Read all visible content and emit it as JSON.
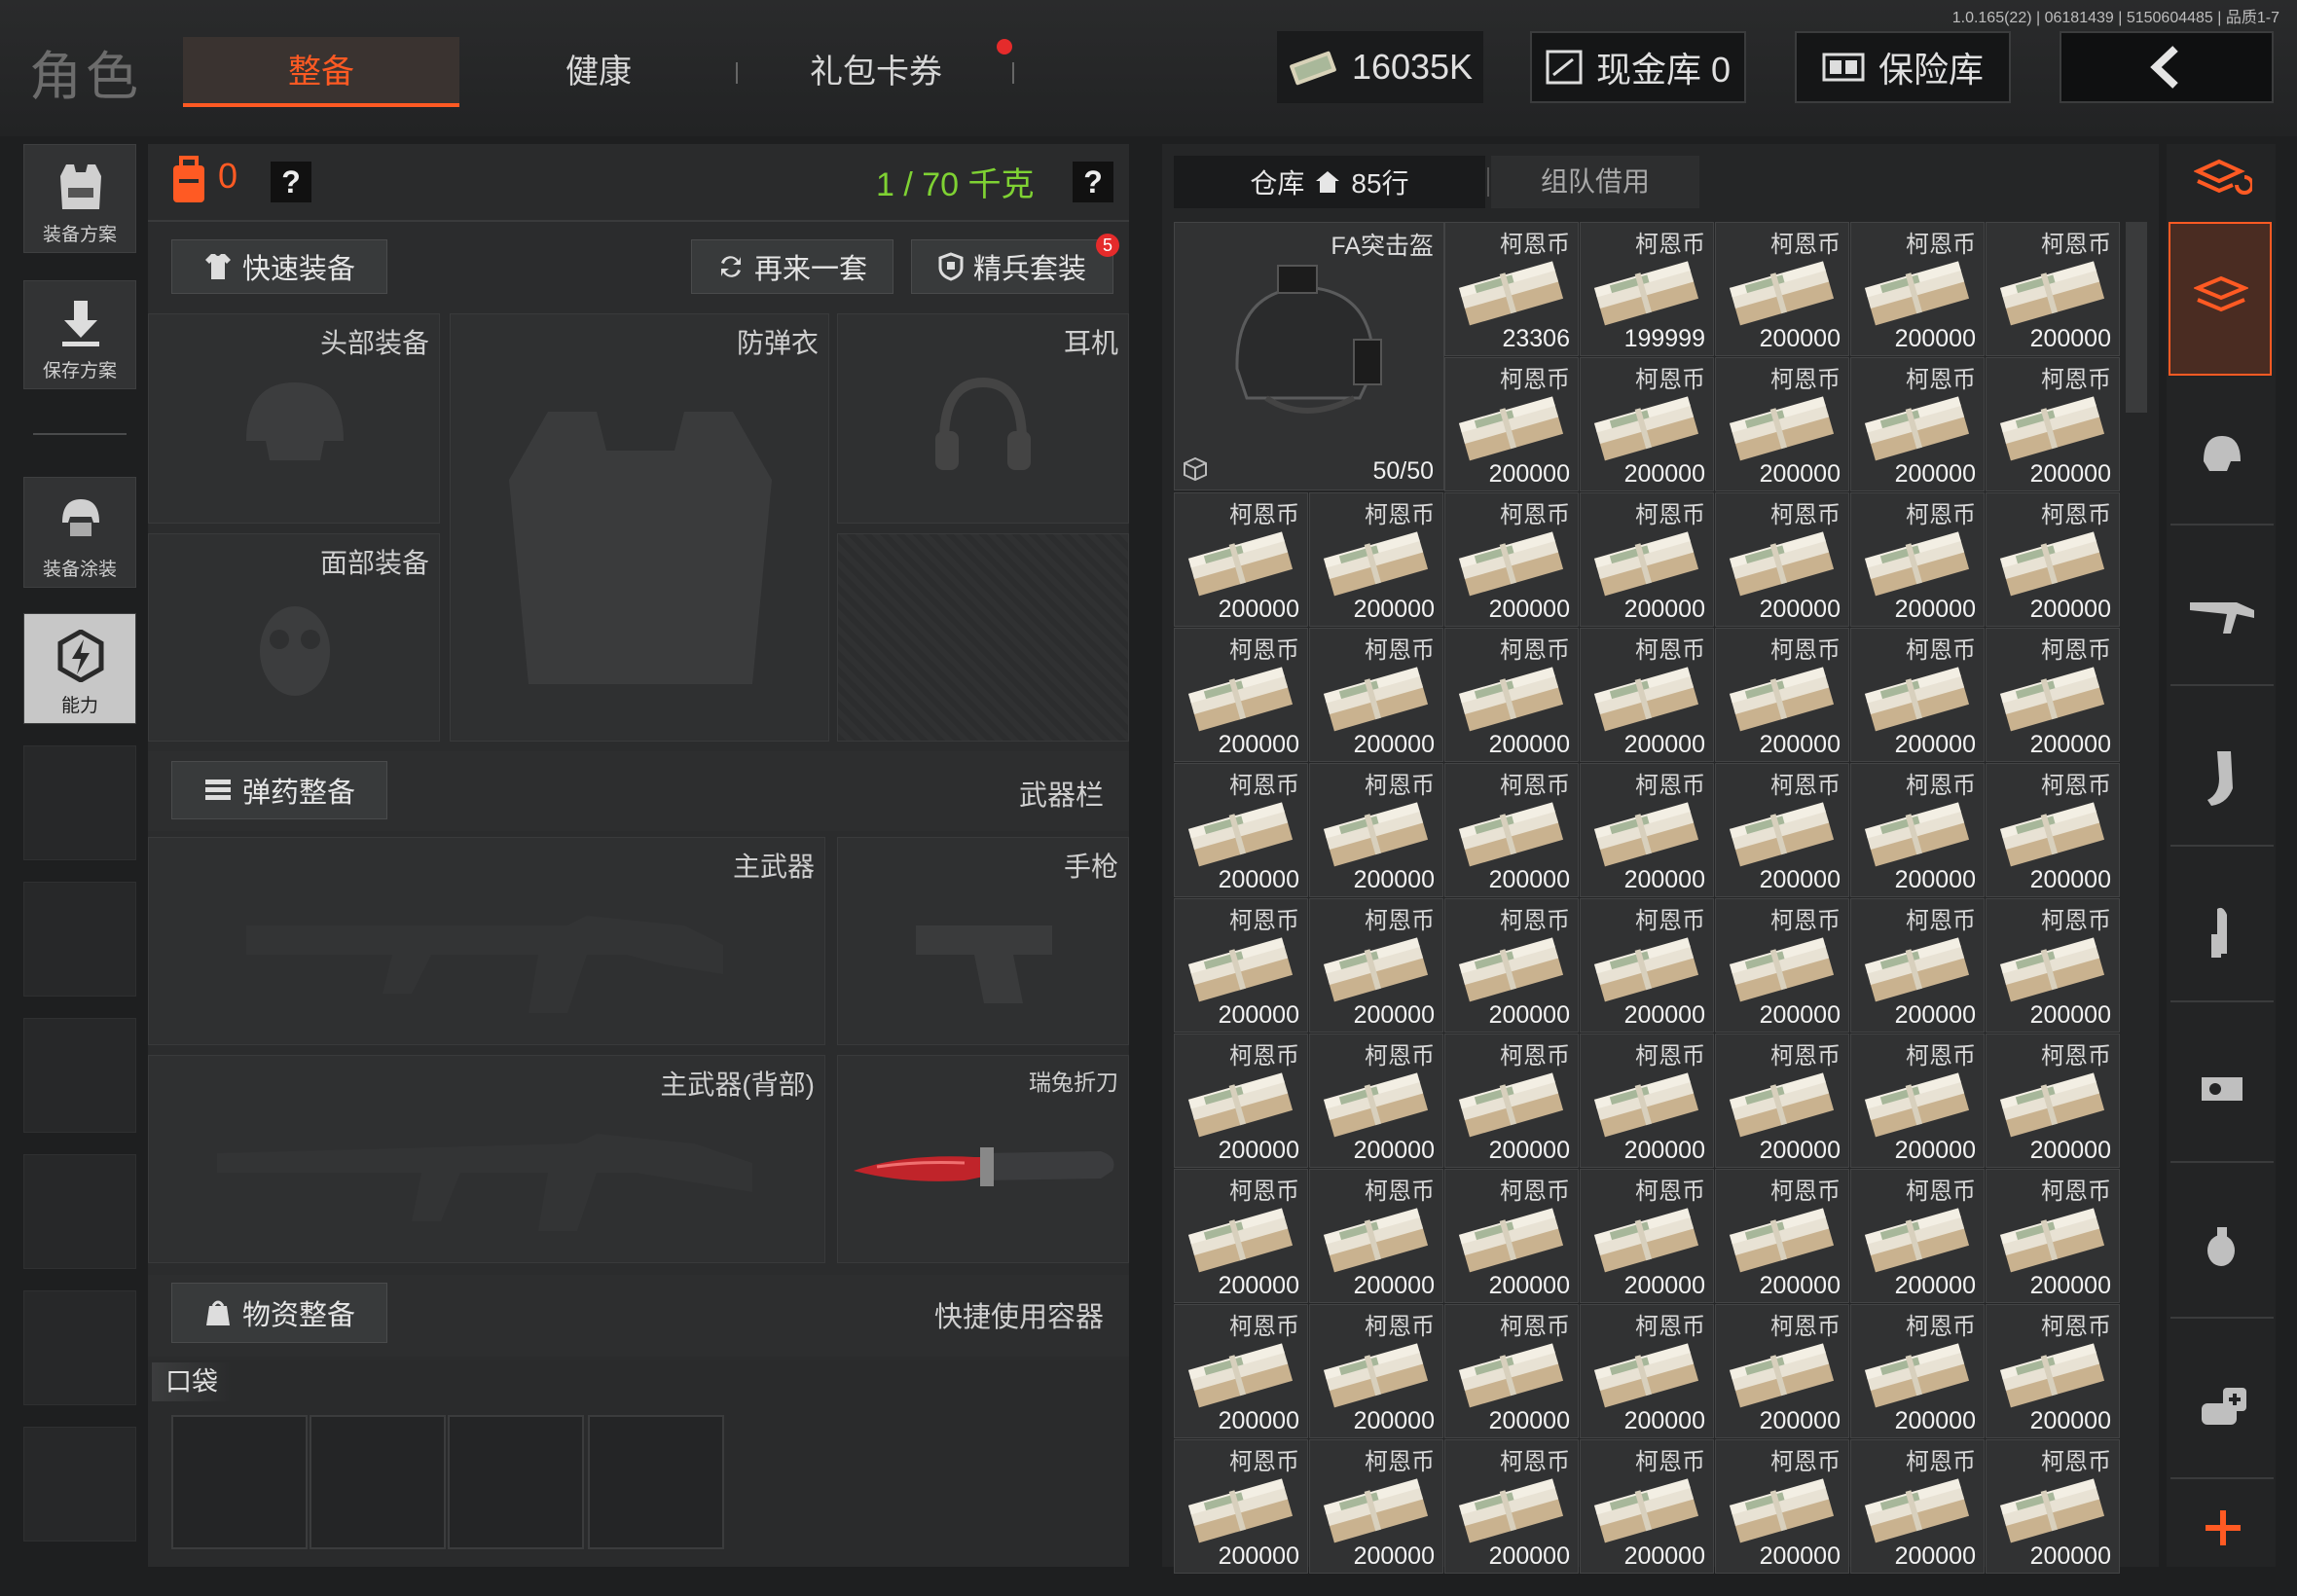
{
  "version": "1.0.165(22) | 06181439 | 5150604485 | 品质1-7",
  "header": {
    "title": "角色",
    "tabs": [
      {
        "label": "整备",
        "active": true
      },
      {
        "label": "健康",
        "active": false
      },
      {
        "label": "礼包卡券",
        "active": false
      }
    ],
    "money": "16035K",
    "cash_vault": "现金库 0",
    "safe": "保险库"
  },
  "left_rail": {
    "items": [
      {
        "label": "装备方案",
        "icon": "vest-icon"
      },
      {
        "label": "保存方案",
        "icon": "download-icon"
      },
      {
        "label": "装备涂装",
        "icon": "helmet-paint-icon"
      },
      {
        "label": "能力",
        "icon": "ability-icon"
      }
    ]
  },
  "gear": {
    "backpack_count": "0",
    "weight": "1 / 70 千克",
    "quick_equip": "快速装备",
    "repeat": "再来一套",
    "elite": "精兵套装",
    "elite_badge": "5",
    "slots": {
      "head": "头部装备",
      "armor": "防弹衣",
      "headset": "耳机",
      "face": "面部装备"
    },
    "ammo_equip": "弹药整备",
    "weapon_bar": "武器栏",
    "primary": "主武器",
    "pistol": "手枪",
    "primary_back": "主武器(背部)",
    "knife": "瑞兔折刀",
    "supply_equip": "物资整备",
    "quick_container": "快捷使用容器",
    "pocket": "口袋"
  },
  "stash": {
    "tab_stash": "仓库",
    "rows": "85行",
    "tab_team": "组队借用",
    "helmet": {
      "name": "FA突击盔",
      "durability": "50/50"
    },
    "item_name": "柯恩币",
    "values": [
      "23306",
      "199999",
      "200000",
      "200000",
      "200000",
      "200000",
      "200000",
      "200000",
      "200000",
      "200000",
      "200000",
      "200000",
      "200000",
      "200000",
      "200000",
      "200000",
      "200000",
      "200000",
      "200000",
      "200000",
      "200000",
      "200000",
      "200000",
      "200000",
      "200000",
      "200000",
      "200000",
      "200000",
      "200000",
      "200000",
      "200000",
      "200000",
      "200000",
      "200000",
      "200000",
      "200000",
      "200000",
      "200000",
      "200000",
      "200000",
      "200000",
      "200000",
      "200000",
      "200000",
      "200000",
      "200000",
      "200000",
      "200000",
      "200000",
      "200000",
      "200000",
      "200000",
      "200000",
      "200000",
      "200000",
      "200000",
      "200000",
      "200000",
      "200000",
      "200000",
      "200000",
      "200000",
      "200000",
      "200000",
      "200000",
      "200000"
    ]
  },
  "colors": {
    "accent": "#ff5a23",
    "weight_green": "#7fd233",
    "badge_red": "#e52b2b"
  }
}
